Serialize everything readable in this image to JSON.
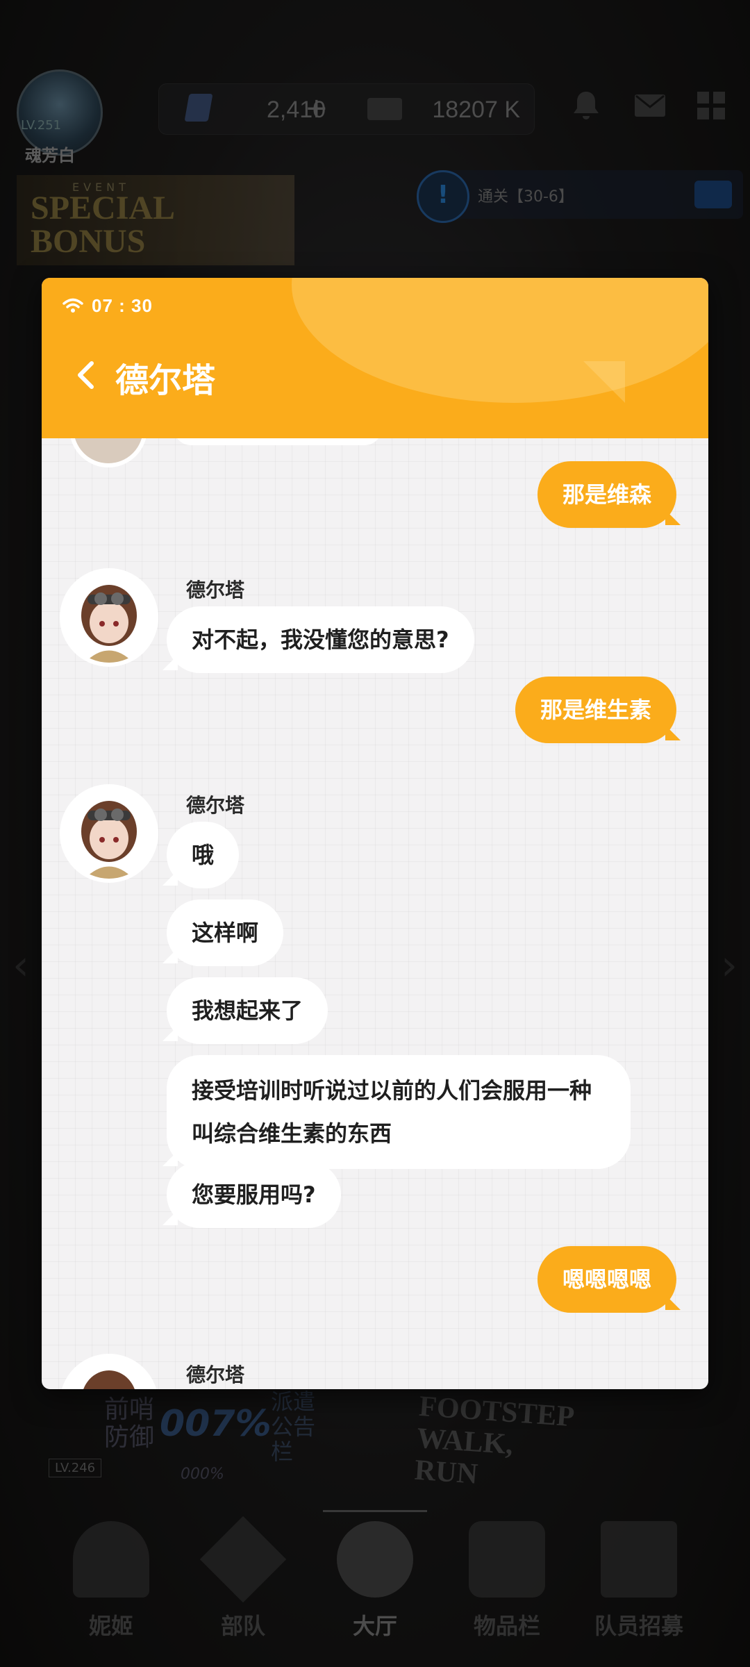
{
  "game": {
    "player": {
      "name": "魂芳白",
      "level": "LV.251"
    },
    "resources": {
      "gems": "2,410",
      "credits": "18207 K"
    },
    "event_banner": {
      "label": "EVENT",
      "title": "SPECIAL BONUS"
    },
    "quest": {
      "text": "通关【30-6】"
    },
    "bottom_banners": {
      "lv": "LV.246",
      "outpost": "前哨防御",
      "outpost_pct": "007%",
      "outpost_pct2": "000%",
      "dispatch": "派遣公告栏",
      "footstep": "FOOTSTEP WALK, RUN"
    },
    "nav": [
      {
        "label": "妮姬"
      },
      {
        "label": "部队"
      },
      {
        "label": "大厅"
      },
      {
        "label": "物品栏"
      },
      {
        "label": "队员招募"
      }
    ]
  },
  "chat": {
    "status_time": "07 : 30",
    "title": "德尔塔",
    "messages": [
      {
        "from": "me",
        "text": "那是维森"
      },
      {
        "from": "them",
        "sender": "德尔塔",
        "text": "对不起，我没懂您的意思?"
      },
      {
        "from": "me",
        "text": "那是维生素"
      },
      {
        "from": "them",
        "sender": "德尔塔",
        "text": "哦"
      },
      {
        "from": "them",
        "text": "这样啊"
      },
      {
        "from": "them",
        "text": "我想起来了"
      },
      {
        "from": "them",
        "text": "接受培训时听说过以前的人们会服用一种叫综合维生素的东西"
      },
      {
        "from": "them",
        "text": "您要服用吗?"
      },
      {
        "from": "me",
        "text": "嗯嗯嗯嗯"
      },
      {
        "from": "them",
        "sender": "德尔塔",
        "text": ""
      }
    ]
  },
  "colors": {
    "accent": "#fbac1b",
    "chat_bg": "#f3f2f3",
    "bubble_them": "#ffffff"
  }
}
